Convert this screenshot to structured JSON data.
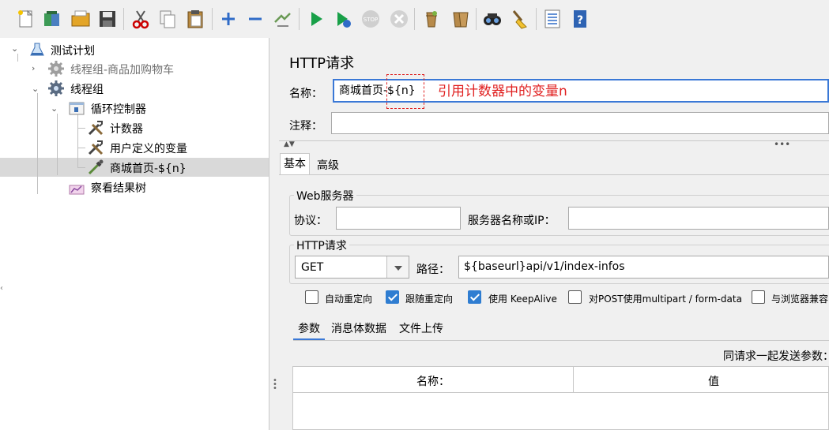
{
  "toolbar": {
    "buttons": [
      {
        "name": "new-icon"
      },
      {
        "name": "templates-icon"
      },
      {
        "name": "open-icon"
      },
      {
        "name": "save-icon"
      },
      {
        "name": "cut-icon"
      },
      {
        "name": "copy-icon"
      },
      {
        "name": "paste-icon"
      },
      {
        "name": "expand-icon"
      },
      {
        "name": "collapse-icon"
      },
      {
        "name": "toggle-icon"
      },
      {
        "name": "start-icon"
      },
      {
        "name": "start-no-pauses-icon"
      },
      {
        "name": "stop-icon"
      },
      {
        "name": "shutdown-icon"
      },
      {
        "name": "clear-icon"
      },
      {
        "name": "clear-all-icon"
      },
      {
        "name": "search-icon"
      },
      {
        "name": "reset-search-icon"
      },
      {
        "name": "function-helper-icon"
      },
      {
        "name": "help-icon"
      }
    ]
  },
  "tree": {
    "items": [
      {
        "label": "测试计划"
      },
      {
        "label": "线程组-商品加购物车"
      },
      {
        "label": "线程组"
      },
      {
        "label": "循环控制器"
      },
      {
        "label": "计数器"
      },
      {
        "label": "用户定义的变量"
      },
      {
        "label": "商城首页-${n}"
      },
      {
        "label": "察看结果树"
      }
    ]
  },
  "panel": {
    "title": "HTTP请求",
    "name_label": "名称：",
    "name_value": "商城首页-${n}",
    "annotation": "引用计数器中的变量n",
    "comment_label": "注释：",
    "comment_value": "",
    "tabs": {
      "basic": "基本",
      "advanced": "高级"
    },
    "web_server": {
      "group_title": "Web服务器",
      "protocol_label": "协议：",
      "protocol_value": "",
      "server_label": "服务器名称或IP：",
      "server_value": ""
    },
    "http_request": {
      "group_title": "HTTP请求",
      "method": "GET",
      "path_label": "路径：",
      "path_value": "${baseurl}api/v1/index-infos"
    },
    "options": [
      {
        "label": "自动重定向",
        "checked": false
      },
      {
        "label": "跟随重定向",
        "checked": true
      },
      {
        "label": "使用 KeepAlive",
        "checked": true
      },
      {
        "label": "对POST使用multipart / form-data",
        "checked": false
      },
      {
        "label": "与浏览器兼容的头",
        "checked": false
      }
    ],
    "sub_tabs": {
      "params": "参数",
      "body": "消息体数据",
      "files": "文件上传"
    },
    "send_params_label": "同请求一起发送参数：",
    "table_headers": {
      "name": "名称：",
      "value": "值"
    }
  },
  "colors": {
    "accent": "#3a78d6",
    "annotation": "#e02020",
    "selection": "#d9d9d9",
    "checkbox": "#2f7dd1"
  }
}
